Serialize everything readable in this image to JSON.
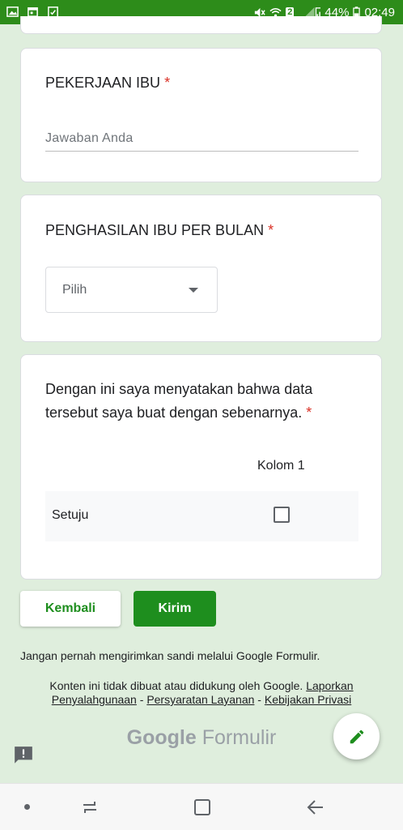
{
  "status_bar": {
    "battery": "44%",
    "time": "02:49",
    "sim_badge": "2"
  },
  "questions": {
    "mother_job": {
      "title": "PEKERJAAN IBU",
      "required": "*",
      "placeholder": "Jawaban Anda"
    },
    "mother_income": {
      "title": "PENGHASILAN IBU PER BULAN",
      "required": "*",
      "selected": "Pilih"
    },
    "declaration": {
      "title": "Dengan ini saya menyatakan bahwa data tersebut saya buat dengan sebenarnya.",
      "required": "*",
      "column_header": "Kolom 1",
      "row_label": "Setuju"
    }
  },
  "buttons": {
    "back": "Kembali",
    "submit": "Kirim"
  },
  "footer": {
    "warning": "Jangan pernah mengirimkan sandi melalui Google Formulir.",
    "disclaimer": "Konten ini tidak dibuat atau didukung oleh Google.",
    "report_link": "Laporkan Penyalahgunaan",
    "sep1": " - ",
    "terms_link": "Persyaratan Layanan",
    "sep2": " - ",
    "privacy_link": "Kebijakan Privasi",
    "brand_google": "Google",
    "brand_product": "Formulir"
  },
  "colors": {
    "accent": "#1e8e1e",
    "status_bar": "#2d8c1a",
    "background": "#dfeedd",
    "required": "#d93025"
  },
  "icons": [
    "image-icon",
    "calendar-icon",
    "checklist-icon",
    "mute-icon",
    "wifi-icon",
    "signal-icon",
    "battery-icon",
    "edit-icon",
    "feedback-icon",
    "recent-apps-icon",
    "home-icon",
    "back-icon"
  ]
}
